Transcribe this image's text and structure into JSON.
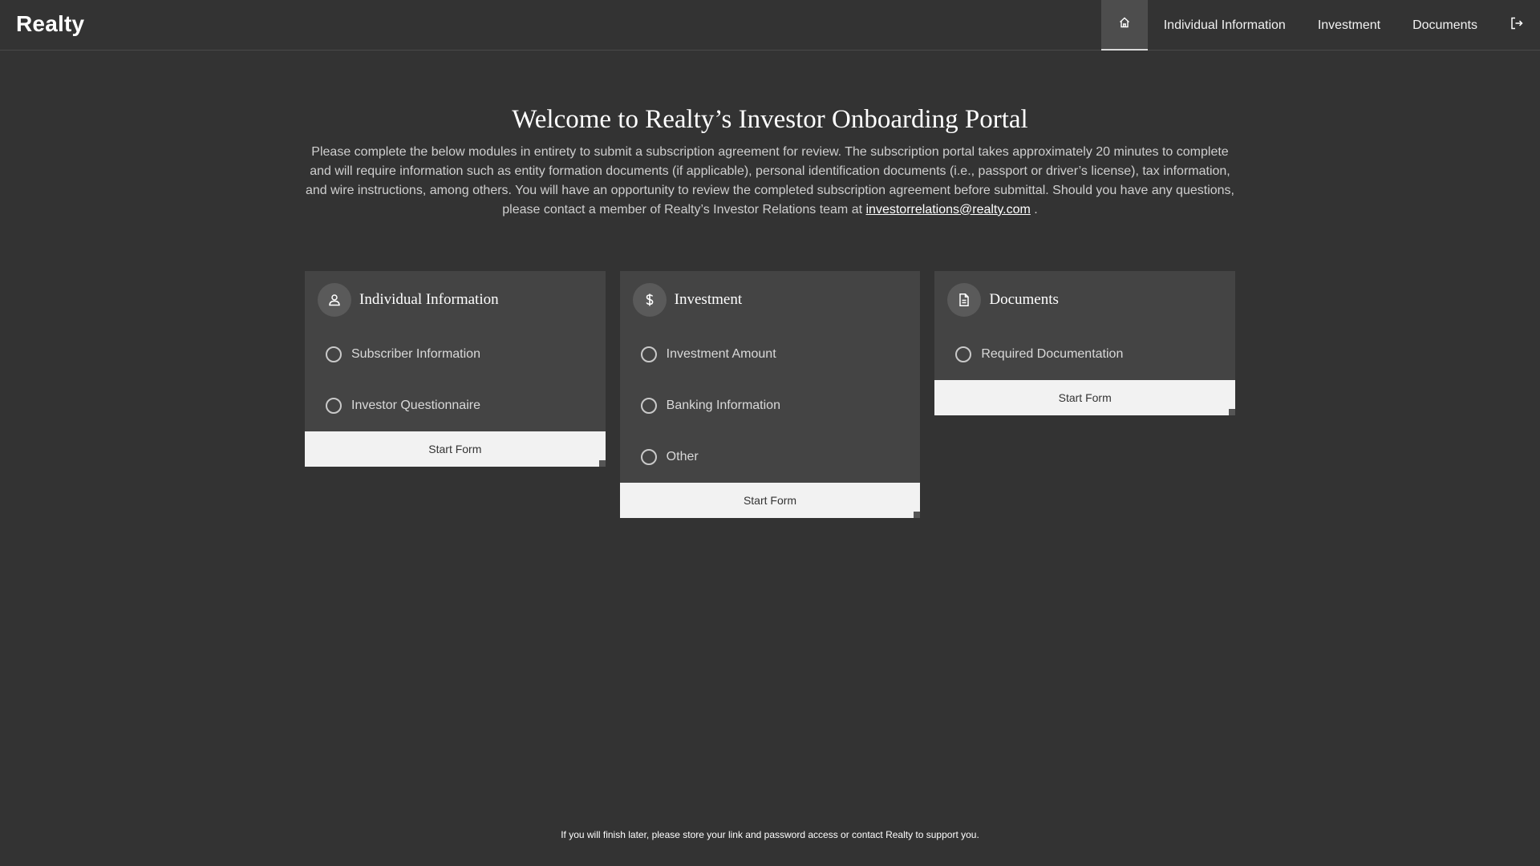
{
  "header": {
    "brand": "Realty",
    "home_icon": "home-icon",
    "nav_items": [
      "Individual Information",
      "Investment",
      "Documents"
    ],
    "logout_icon": "logout-icon"
  },
  "intro": {
    "title": "Welcome to Realty’s Investor Onboarding Portal",
    "body": "Please complete the below modules in entirety to submit a subscription agreement for review. The subscription portal takes approximately 20 minutes to complete and will require information such as entity formation documents (if applicable), personal identification documents (i.e., passport or driver’s license), tax information, and wire instructions, among others. You will have an opportunity to review the completed subscription agreement before submittal. Should you have any questions, please contact a member of Realty’s Investor Relations team at",
    "email": "investorrelations@realty.com",
    "trailing": " ."
  },
  "cards": [
    {
      "title": "Individual Information",
      "icon": "person-icon",
      "items": [
        "Subscriber Information",
        "Investor Questionnaire"
      ],
      "button": "Start Form"
    },
    {
      "title": "Investment",
      "icon": "dollar-icon",
      "items": [
        "Investment Amount",
        "Banking Information",
        "Other"
      ],
      "button": "Start Form"
    },
    {
      "title": "Documents",
      "icon": "document-icon",
      "items": [
        "Required Documentation"
      ],
      "button": "Start Form"
    }
  ],
  "footer": {
    "note": "If you will finish later, please store your link and password access or contact Realty to support you."
  }
}
